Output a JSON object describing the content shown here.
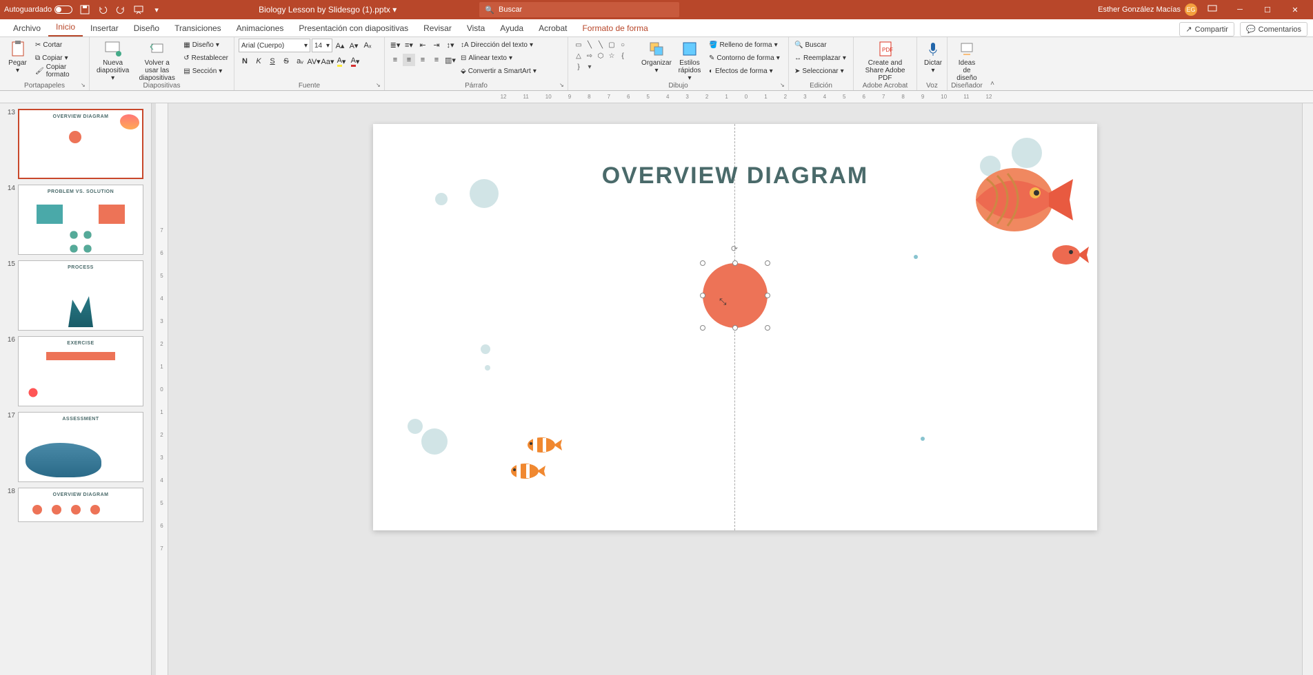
{
  "titleBar": {
    "autosave": "Autoguardado",
    "fileName": "Biology Lesson by Slidesgo (1).pptx",
    "searchPlaceholder": "Buscar",
    "userName": "Esther González Macías",
    "userInitials": "EG"
  },
  "tabs": {
    "archivo": "Archivo",
    "inicio": "Inicio",
    "insertar": "Insertar",
    "diseno": "Diseño",
    "transiciones": "Transiciones",
    "animaciones": "Animaciones",
    "presentacion": "Presentación con diapositivas",
    "revisar": "Revisar",
    "vista": "Vista",
    "ayuda": "Ayuda",
    "acrobat": "Acrobat",
    "formato": "Formato de forma",
    "compartir": "Compartir",
    "comentarios": "Comentarios"
  },
  "ribbon": {
    "portapapeles": {
      "label": "Portapapeles",
      "pegar": "Pegar",
      "cortar": "Cortar",
      "copiar": "Copiar",
      "copiarFormato": "Copiar formato"
    },
    "diapositivas": {
      "label": "Diapositivas",
      "nueva": "Nueva diapositiva",
      "volver": "Volver a usar las diapositivas",
      "diseno": "Diseño",
      "restablecer": "Restablecer",
      "seccion": "Sección"
    },
    "fuente": {
      "label": "Fuente",
      "fontName": "Arial (Cuerpo)",
      "fontSize": "14"
    },
    "parrafo": {
      "label": "Párrafo",
      "direccion": "Dirección del texto",
      "alinear": "Alinear texto",
      "smartart": "Convertir a SmartArt"
    },
    "dibujo": {
      "label": "Dibujo",
      "organizar": "Organizar",
      "estilos": "Estilos rápidos",
      "relleno": "Relleno de forma",
      "contorno": "Contorno de forma",
      "efectos": "Efectos de forma"
    },
    "edicion": {
      "label": "Edición",
      "buscar": "Buscar",
      "reemplazar": "Reemplazar",
      "seleccionar": "Seleccionar"
    },
    "acrobat": {
      "label": "Adobe Acrobat",
      "createShare": "Create and Share Adobe PDF"
    },
    "voz": {
      "label": "Voz",
      "dictar": "Dictar"
    },
    "disenador": {
      "label": "Diseñador",
      "ideas": "Ideas de diseño"
    }
  },
  "slides": {
    "n13": "13",
    "t13": "OVERVIEW DIAGRAM",
    "n14": "14",
    "t14": "PROBLEM VS. SOLUTION",
    "n15": "15",
    "t15": "PROCESS",
    "n16": "16",
    "t16": "EXERCISE",
    "n17": "17",
    "t17": "ASSESSMENT",
    "n18": "18",
    "t18": "OVERVIEW DIAGRAM"
  },
  "canvas": {
    "title": "OVERVIEW DIAGRAM"
  },
  "rulerH": [
    "1",
    "2",
    "3",
    "4",
    "5",
    "6",
    "7",
    "8",
    "9",
    "10",
    "11",
    "12",
    "0",
    "1",
    "2",
    "3",
    "4",
    "5",
    "6",
    "7",
    "8",
    "9",
    "10",
    "11",
    "12"
  ],
  "rulerV": [
    "7",
    "6",
    "5",
    "4",
    "3",
    "2",
    "1",
    "0",
    "1",
    "2",
    "3",
    "4",
    "5",
    "6",
    "7"
  ]
}
